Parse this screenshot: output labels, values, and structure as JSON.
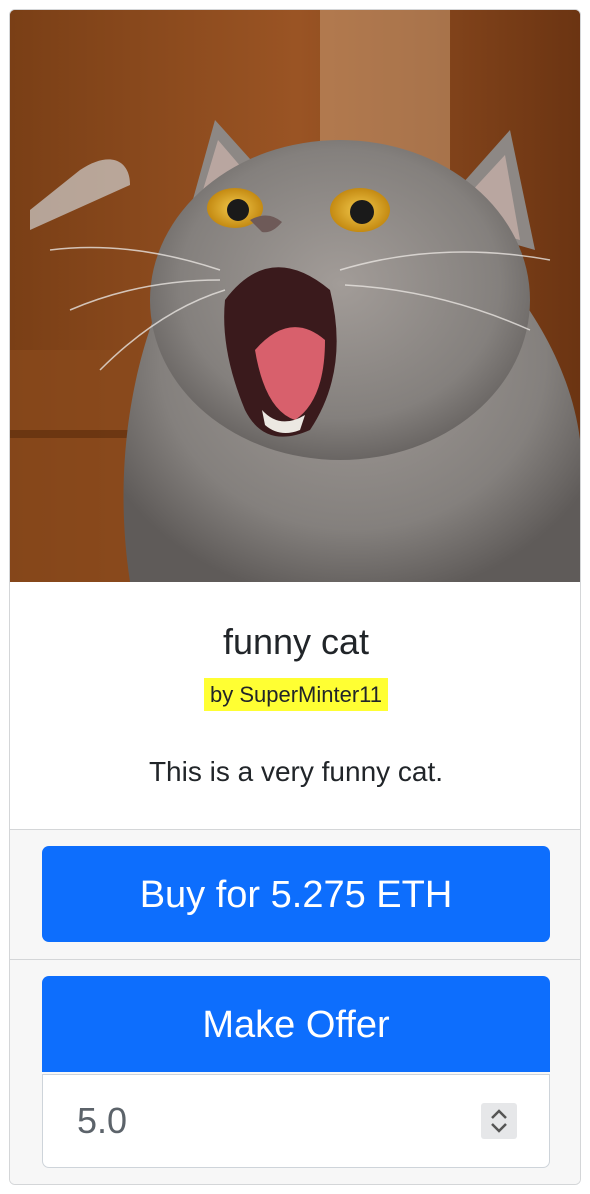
{
  "nft": {
    "title": "funny cat",
    "creator": "by SuperMinter11",
    "description": "This is a very funny cat."
  },
  "actions": {
    "buy_label": "Buy for 5.275 ETH",
    "offer_label": "Make Offer",
    "offer_value": "5.0"
  },
  "colors": {
    "primary": "#0d6efd",
    "highlight": "#ffff33"
  },
  "icons": {
    "spinner": "spin-updown-icon"
  }
}
